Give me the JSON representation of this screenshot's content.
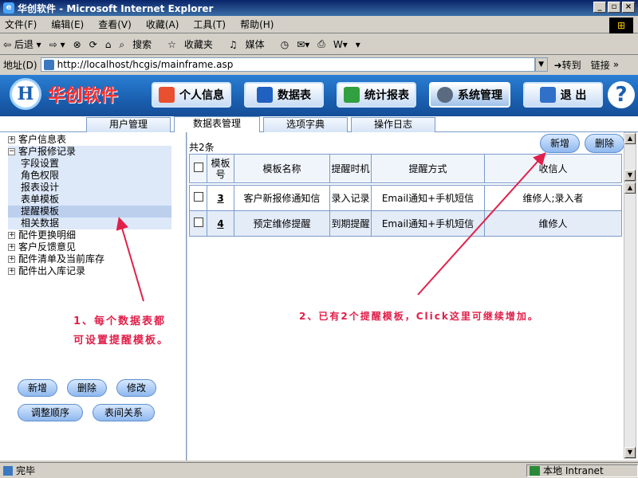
{
  "window": {
    "title": "华创软件 - Microsoft Internet Explorer",
    "btn_min": "_",
    "btn_max": "▫",
    "btn_close": "×"
  },
  "menu": [
    "文件(F)",
    "编辑(E)",
    "查看(V)",
    "收藏(A)",
    "工具(T)",
    "帮助(H)"
  ],
  "toolbar": {
    "back": "⇦ 后退 ▾",
    "forward": "⇨ ▾",
    "stop": "⊗",
    "refresh": "⟳",
    "home": "⌂",
    "search": "搜索",
    "favorites": "收藏夹",
    "media": "媒体",
    "history": "◷",
    "mail": "✉▾",
    "print": "⎙",
    "edit": "W▾",
    "extra": "▾"
  },
  "address": {
    "label": "地址(D)",
    "url": "http://localhost/hcgis/mainframe.asp",
    "go": "转到",
    "links": "链接",
    "more": "»"
  },
  "app": {
    "logo_mark": "H",
    "logo_text": "华创软件",
    "nav": [
      "个人信息",
      "数据表",
      "统计报表",
      "系统管理",
      "退 出"
    ],
    "help": "?"
  },
  "tabs": [
    "用户管理",
    "数据表管理",
    "选项字典",
    "操作日志"
  ],
  "tree": {
    "items": [
      {
        "label": "客户信息表",
        "toggle": "+"
      },
      {
        "label": "客户报修记录",
        "toggle": "−"
      },
      {
        "label": "配件更换明细",
        "toggle": "+"
      },
      {
        "label": "客户反馈意见",
        "toggle": "+"
      },
      {
        "label": "配件清单及当前库存",
        "toggle": "+"
      },
      {
        "label": "配件出入库记录",
        "toggle": "+"
      }
    ],
    "children": [
      "字段设置",
      "角色权限",
      "报表设计",
      "表单模板",
      "提醒模板",
      "相关数据"
    ]
  },
  "left_buttons": [
    "新增",
    "删除",
    "修改",
    "调整顺序",
    "表间关系"
  ],
  "annotations": {
    "left_line1": "1、每个数据表都",
    "left_line2": "可设置提醒模板。",
    "right": "2、已有2个提醒模板，Click这里可继续增加。"
  },
  "grid": {
    "count_text": "共2条",
    "add_button": "新增",
    "delete_button": "删除",
    "headers": [
      "模板号",
      "模板名称",
      "提醒时机",
      "提醒方式",
      "收信人"
    ],
    "rows": [
      {
        "id": "3",
        "name": "客户新报修通知信",
        "timing": "录入记录",
        "method": "Email通知+手机短信",
        "recipients": "维修人;录入者"
      },
      {
        "id": "4",
        "name": "预定维修提醒",
        "timing": "到期提醒",
        "method": "Email通知+手机短信",
        "recipients": "维修人"
      }
    ]
  },
  "status": {
    "text": "完毕",
    "zone": "本地 Intranet"
  }
}
